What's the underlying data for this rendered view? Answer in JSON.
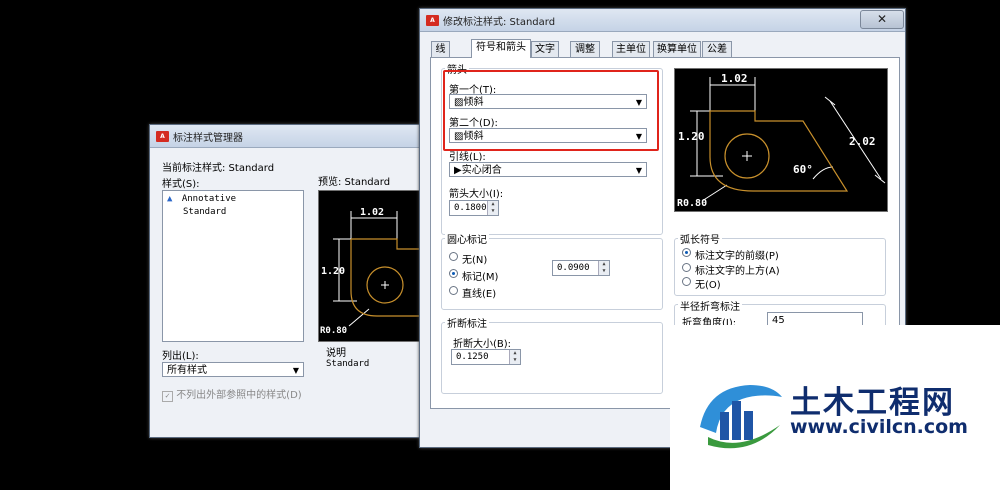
{
  "manager": {
    "title": "标注样式管理器",
    "current_style_label": "当前标注样式: Standard",
    "styles_label": "样式(S):",
    "styles": [
      "Annotative",
      "Standard"
    ],
    "preview_label": "预览: Standard",
    "list_label": "列出(L):",
    "list_value": "所有样式",
    "xref_checkbox": "不列出外部参照中的样式(D)",
    "desc_label": "说明",
    "desc_value": "Standard",
    "preview": {
      "dim_top": "1.02",
      "dim_left": "1.20",
      "radius": "R0.80"
    }
  },
  "modify": {
    "title": "修改标注样式: Standard",
    "close_glyph": "✕",
    "tabs": [
      "线",
      "符号和箭头",
      "文字",
      "调整",
      "主单位",
      "换算单位",
      "公差"
    ],
    "active_tab": "符号和箭头",
    "arrows_group": "箭头",
    "first_label": "第一个(T):",
    "first_value": "倾斜",
    "second_label": "第二个(D):",
    "second_value": "倾斜",
    "leader_label": "引线(L):",
    "leader_value": "实心闭合",
    "arrow_size_label": "箭头大小(I):",
    "arrow_size_value": "0.1800",
    "center_group": "圆心标记",
    "center_none": "无(N)",
    "center_mark": "标记(M)",
    "center_line": "直线(E)",
    "center_value": "0.0900",
    "break_group": "折断标注",
    "break_size_label": "折断大小(B):",
    "break_size_value": "0.1250",
    "arc_group": "弧长符号",
    "arc_before": "标注文字的前缀(P)",
    "arc_above": "标注文字的上方(A)",
    "arc_none": "无(O)",
    "jog_group": "半径折弯标注",
    "jog_angle_label": "折弯角度(J):",
    "jog_angle_value": "45",
    "preview": {
      "dim_top": "1.02",
      "dim_left": "1.20",
      "dim_right": "2.02",
      "angle": "60°",
      "radius": "R0.80"
    }
  },
  "watermark": {
    "brand": "土木工程网",
    "url": "www.civilcn.com"
  },
  "colors": {
    "highlight": "#e0241b",
    "cad_orange": "#c8902c",
    "brand_blue": "#0f2d6e"
  }
}
